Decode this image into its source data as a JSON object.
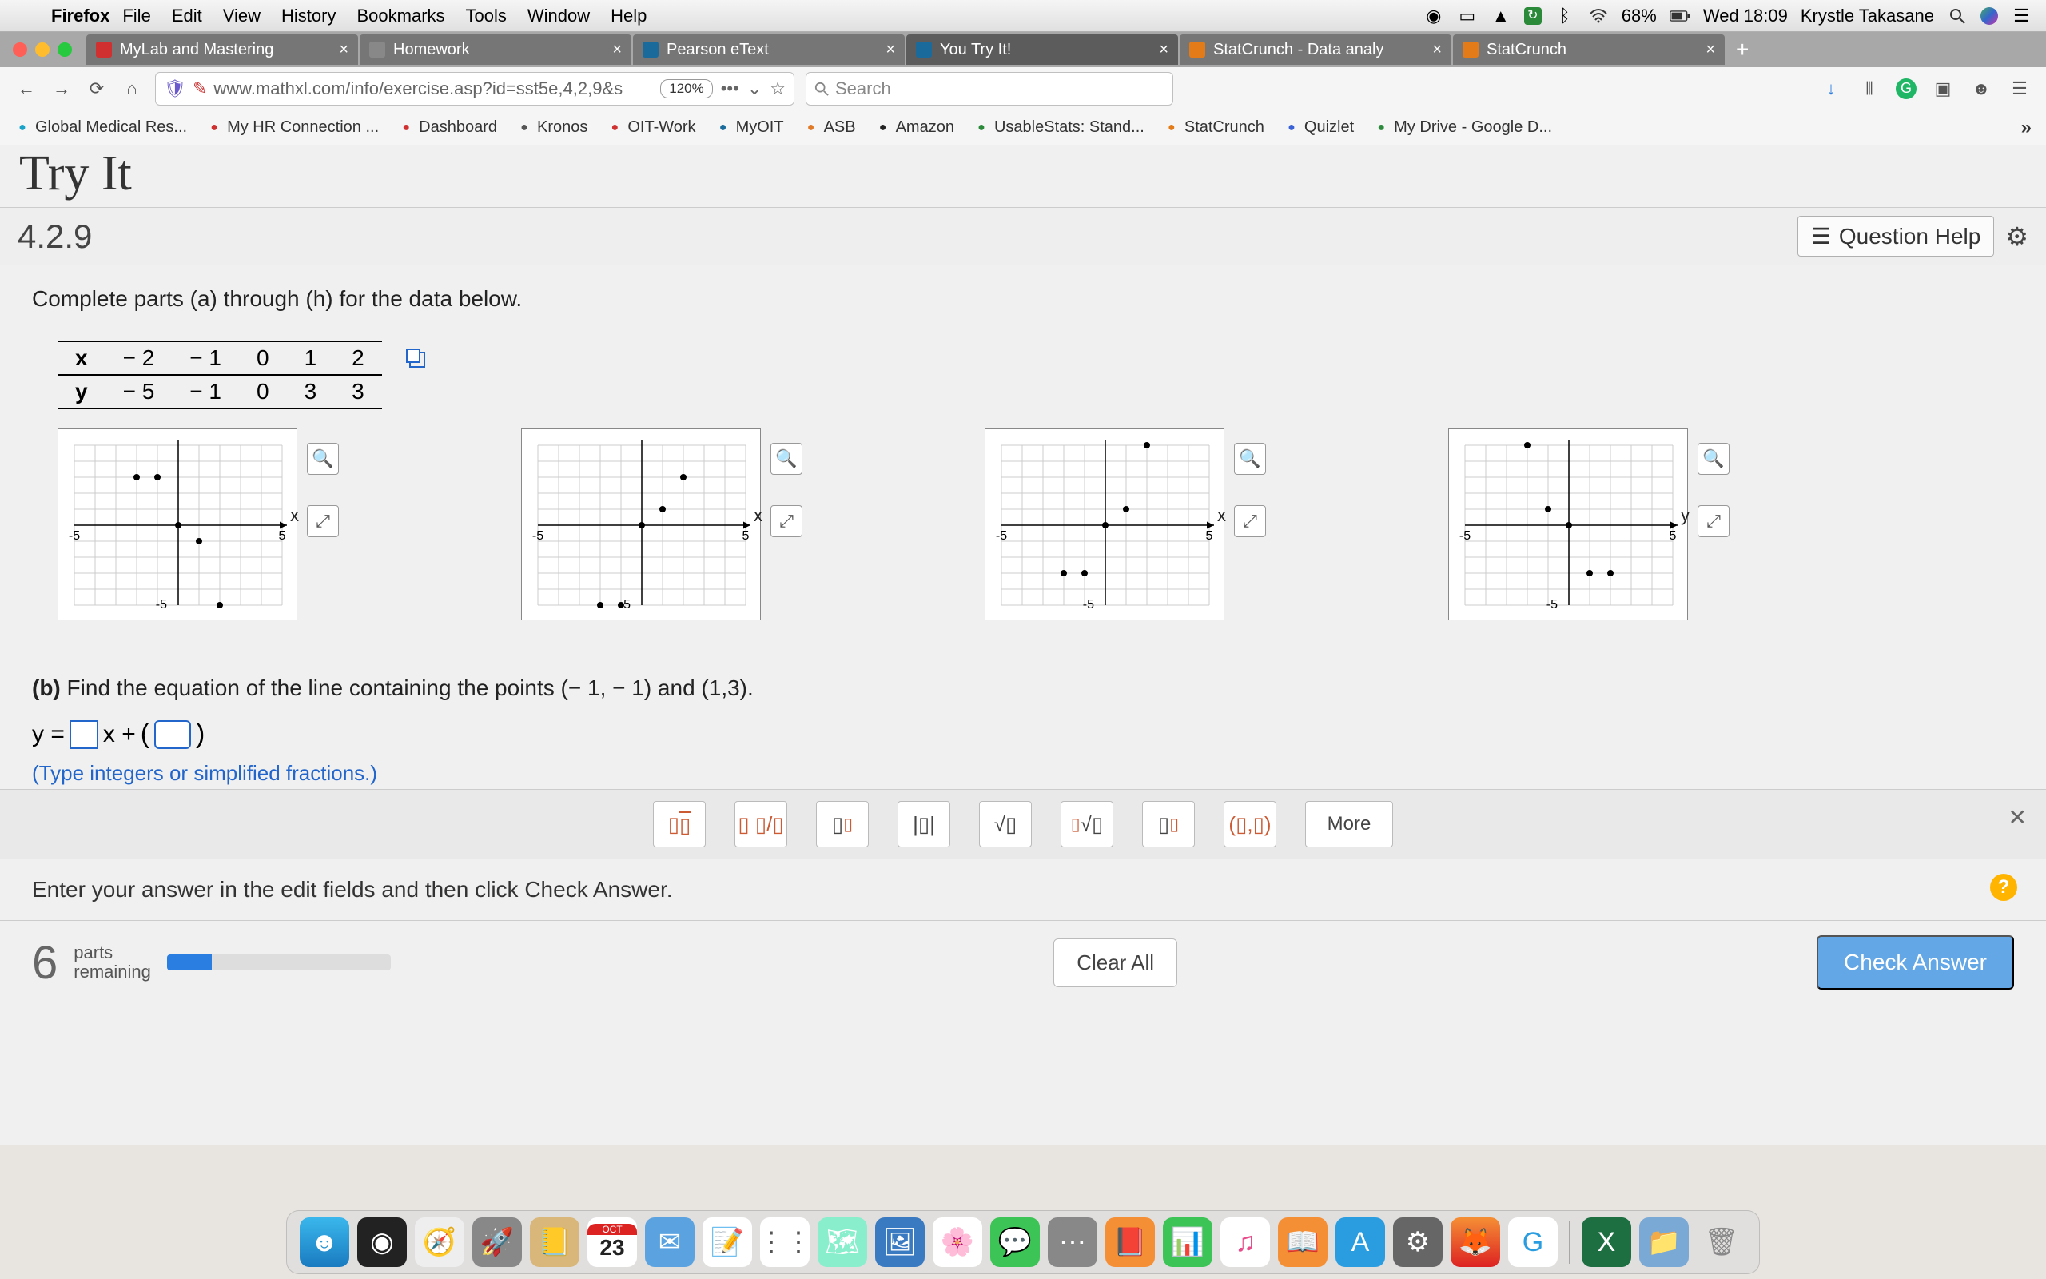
{
  "menubar": {
    "app": "Firefox",
    "items": [
      "File",
      "Edit",
      "View",
      "History",
      "Bookmarks",
      "Tools",
      "Window",
      "Help"
    ],
    "battery": "68%",
    "clock": "Wed 18:09",
    "user": "Krystle Takasane"
  },
  "tabs": [
    {
      "label": "MyLab and Mastering",
      "fav": "#d03030"
    },
    {
      "label": "Homework",
      "fav": "#888"
    },
    {
      "label": "Pearson eText",
      "fav": "#1a6b9c"
    },
    {
      "label": "You Try It!",
      "fav": "#1a6b9c",
      "active": true
    },
    {
      "label": "StatCrunch - Data analy",
      "fav": "#e27b18"
    },
    {
      "label": "StatCrunch",
      "fav": "#e27b18"
    }
  ],
  "url": "www.mathxl.com/info/exercise.asp?id=sst5e,4,2,9&s",
  "zoom": "120%",
  "search_ph": "Search",
  "bookmarks": [
    {
      "label": "Global Medical Res...",
      "c": "#1aa3c9"
    },
    {
      "label": "My HR Connection ...",
      "c": "#d03030"
    },
    {
      "label": "Dashboard",
      "c": "#d03030"
    },
    {
      "label": "Kronos",
      "c": "#555"
    },
    {
      "label": "OIT-Work",
      "c": "#d03030"
    },
    {
      "label": "MyOIT",
      "c": "#1a6b9c"
    },
    {
      "label": "ASB",
      "c": "#e07a28"
    },
    {
      "label": "Amazon",
      "c": "#222"
    },
    {
      "label": "UsableStats: Stand...",
      "c": "#2a8a3a"
    },
    {
      "label": "StatCrunch",
      "c": "#e27b18"
    },
    {
      "label": "Quizlet",
      "c": "#3a62d6"
    },
    {
      "label": "My Drive - Google D...",
      "c": "#2a8a3a"
    }
  ],
  "page_title": "Try It",
  "question_number": "4.2.9",
  "question_help": "Question Help",
  "prompt": "Complete parts (a) through (h) for the data below.",
  "table": {
    "xlabel": "x",
    "ylabel": "y",
    "x": [
      "− 2",
      "− 1",
      "0",
      "1",
      "2"
    ],
    "y": [
      "− 5",
      "− 1",
      "0",
      "3",
      "3"
    ]
  },
  "partb_text": "Find the equation of the line containing the points (− 1, − 1) and (1,3).",
  "partb_tag": "(b)",
  "eq_prefix": "y =",
  "eq_mid": "x +",
  "eq_hint": "(Type integers or simplified fractions.)",
  "palette": [
    "frac",
    "mixed",
    "power",
    "abs",
    "sqrt",
    "nroot",
    "sub",
    "(▯,▯)"
  ],
  "palette_more": "More",
  "instruction": "Enter your answer in the edit fields and then click Check Answer.",
  "parts_remaining_num": "6",
  "parts_remaining_lbl1": "parts",
  "parts_remaining_lbl2": "remaining",
  "clear_all": "Clear All",
  "check_answer": "Check Answer",
  "chart_data": [
    {
      "type": "scatter",
      "xlim": [
        -5,
        5
      ],
      "ylim": [
        -5,
        5
      ],
      "points": [
        [
          -2,
          3
        ],
        [
          -1,
          3
        ],
        [
          0,
          0
        ],
        [
          1,
          -1
        ],
        [
          2,
          -5
        ]
      ],
      "xlabel": "x"
    },
    {
      "type": "scatter",
      "xlim": [
        -5,
        5
      ],
      "ylim": [
        -5,
        5
      ],
      "points": [
        [
          -2,
          -5
        ],
        [
          -1,
          -5
        ],
        [
          0,
          0
        ],
        [
          1,
          1
        ],
        [
          2,
          3
        ]
      ],
      "xlabel": "x"
    },
    {
      "type": "scatter",
      "xlim": [
        -5,
        5
      ],
      "ylim": [
        -5,
        5
      ],
      "points": [
        [
          -2,
          -3
        ],
        [
          -1,
          -3
        ],
        [
          0,
          0
        ],
        [
          1,
          1
        ],
        [
          2,
          5
        ]
      ],
      "xlabel": "x"
    },
    {
      "type": "scatter",
      "xlim": [
        -5,
        5
      ],
      "ylim": [
        -5,
        5
      ],
      "points": [
        [
          -2,
          5
        ],
        [
          -1,
          1
        ],
        [
          0,
          0
        ],
        [
          1,
          -3
        ],
        [
          2,
          -3
        ]
      ],
      "xlabel": "y"
    }
  ],
  "dock_date": "23",
  "dock_month": "OCT"
}
